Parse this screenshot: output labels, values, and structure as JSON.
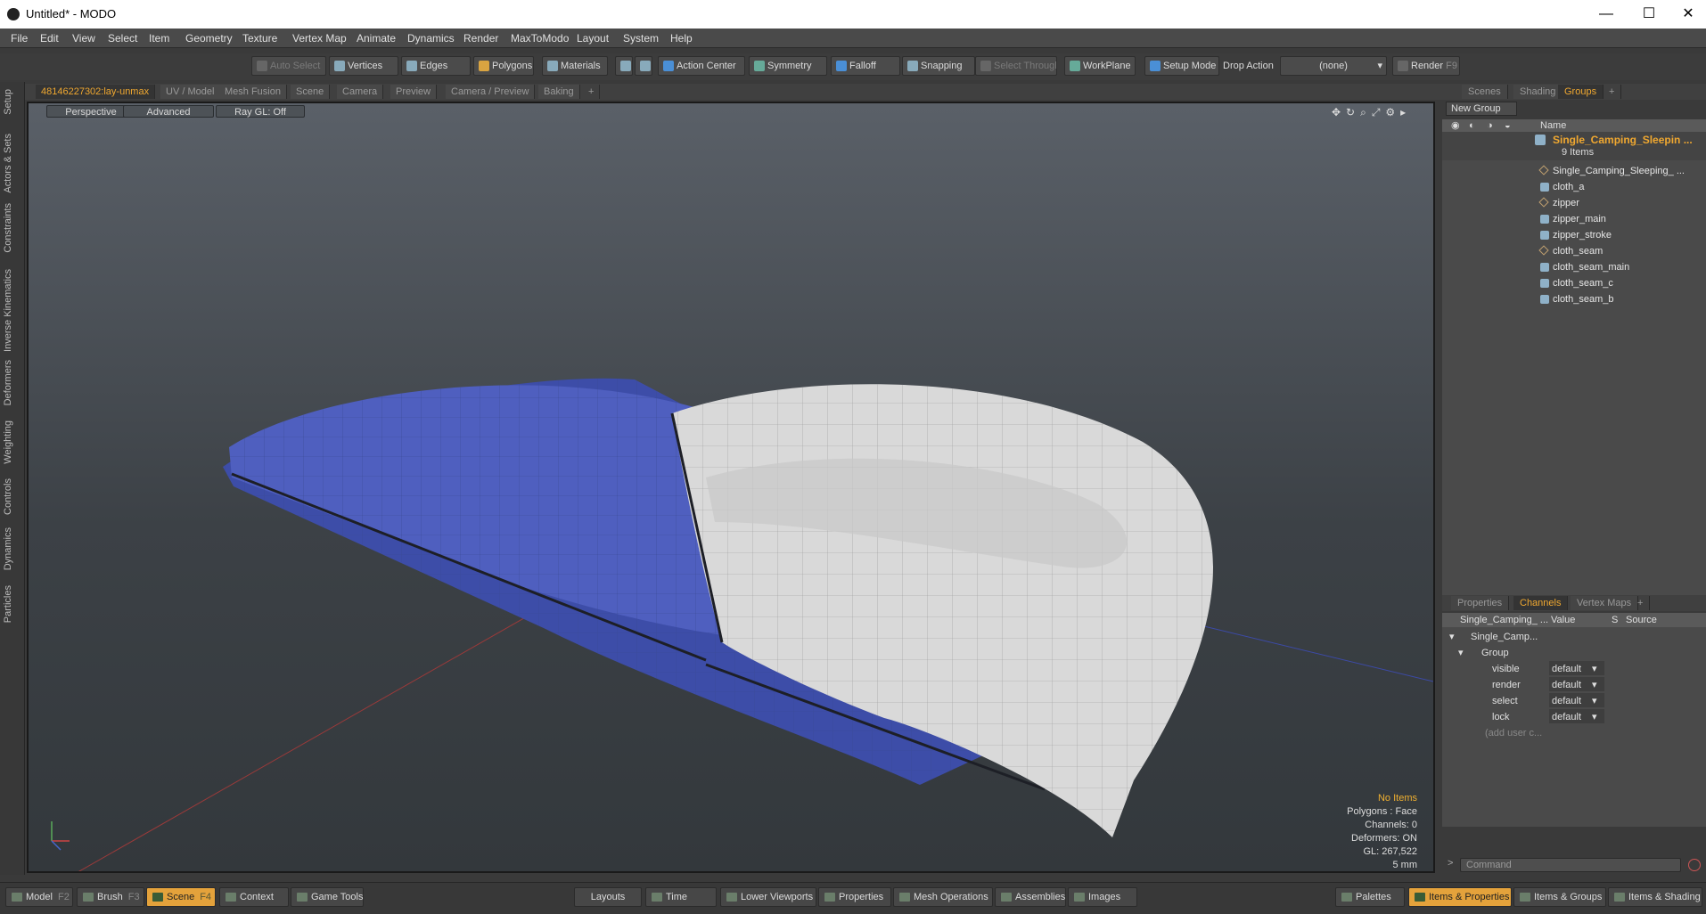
{
  "window": {
    "title": "Untitled* - MODO",
    "minimize": "—",
    "maximize": "☐",
    "close": "✕"
  },
  "menu": [
    "File",
    "Edit",
    "View",
    "Select",
    "Item",
    "Geometry",
    "Texture",
    "Vertex Map",
    "Animate",
    "Dynamics",
    "Render",
    "MaxToModo",
    "Layout",
    "System",
    "Help"
  ],
  "toolbar": {
    "auto_select": "Auto Select",
    "vertices": "Vertices",
    "edges": "Edges",
    "polygons": "Polygons",
    "materials": "Materials",
    "action_center": "Action Center",
    "symmetry": "Symmetry",
    "falloff": "Falloff",
    "snapping": "Snapping",
    "select_through": "Select Through",
    "workplane": "WorkPlane",
    "setup_mode": "Setup Mode",
    "drop_action_label": "Drop Action",
    "drop_action_value": "(none)",
    "render": "Render",
    "render_key": "F9"
  },
  "left_tabs": [
    "Setup",
    "Actors & Sets",
    "Constraints",
    "Inverse Kinematics",
    "Deformers",
    "Weighting",
    "Controls",
    "Dynamics",
    "Particles"
  ],
  "viewport_tabs": [
    "48146227302:lay-unmax",
    "UV / Model",
    "Mesh Fusion",
    "Scene",
    "Camera",
    "Preview",
    "Camera / Preview",
    "Baking",
    "+"
  ],
  "viewport": {
    "view": "Perspective",
    "shading": "Advanced",
    "raygl": "Ray GL: Off",
    "hud": {
      "items": "No Items",
      "polygons": "Polygons : Face",
      "channels": "Channels: 0",
      "deformers": "Deformers: ON",
      "gl": "GL: 267,522",
      "unit": "5 mm"
    }
  },
  "right_tabs": [
    "Scenes",
    "Shading",
    "Groups",
    "+"
  ],
  "groups": {
    "new_group": "New Group",
    "name_col": "Name",
    "root": "Single_Camping_Sleepin ...",
    "root_count": "9 Items",
    "items": [
      "Single_Camping_Sleeping_ ...",
      "cloth_a",
      "zipper",
      "zipper_main",
      "zipper_stroke",
      "cloth_seam",
      "cloth_seam_main",
      "cloth_seam_c",
      "cloth_seam_b"
    ]
  },
  "channel_tabs": [
    "Properties",
    "Channels",
    "Vertex Maps",
    "+"
  ],
  "channels": {
    "col_name": "Single_Camping_ ...",
    "col_value": "Value",
    "col_s": "S",
    "col_source": "Source",
    "item": "Single_Camp...",
    "group": "Group",
    "rows": [
      {
        "name": "visible",
        "value": "default"
      },
      {
        "name": "render",
        "value": "default"
      },
      {
        "name": "select",
        "value": "default"
      },
      {
        "name": "lock",
        "value": "default"
      }
    ],
    "add_user": "(add user c..."
  },
  "command_placeholder": "Command",
  "bottom": {
    "model": "Model",
    "model_key": "F2",
    "brush": "Brush",
    "brush_key": "F3",
    "scene": "Scene",
    "scene_key": "F4",
    "context": "Context",
    "game_tools": "Game Tools",
    "layouts": "Layouts",
    "time": "Time",
    "lower_viewports": "Lower Viewports",
    "properties": "Properties",
    "mesh_operations": "Mesh Operations",
    "assemblies": "Assemblies",
    "images": "Images",
    "palettes": "Palettes",
    "items_properties": "Items & Properties",
    "items_groups": "Items & Groups",
    "items_shading": "Items & Shading"
  },
  "colors": {
    "accent": "#f0a830",
    "selection": "#e4a23b"
  }
}
